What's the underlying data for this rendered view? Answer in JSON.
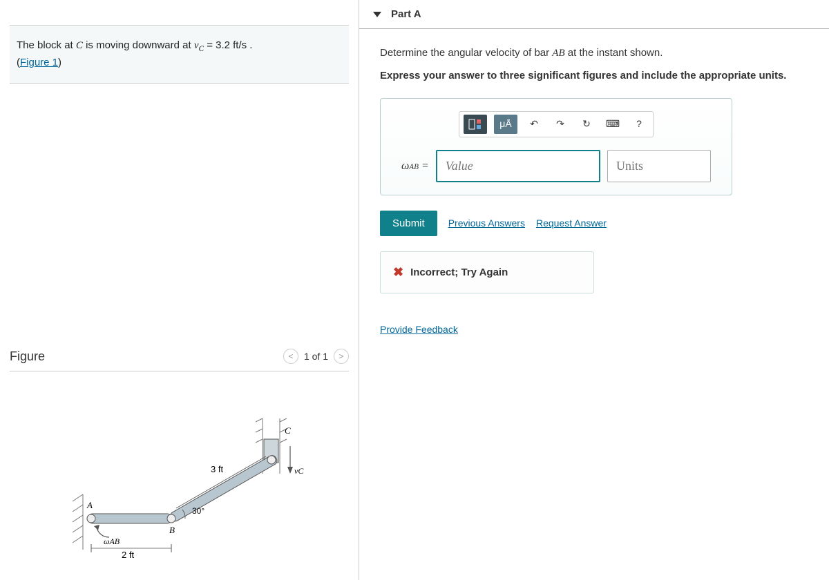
{
  "problem": {
    "text_pre": "The block at ",
    "var1": "C",
    "text_mid1": " is moving downward at ",
    "var2_html": "v",
    "sub2": "C",
    "eq": " = 3.2 ft/s .",
    "figure_link": "Figure 1"
  },
  "figure": {
    "title": "Figure",
    "pager": "1 of 1",
    "labels": {
      "len_bc": "3 ft",
      "len_ab": "2 ft",
      "angle": "30°",
      "A": "A",
      "B": "B",
      "C": "C",
      "wab": "ωAB",
      "vc": "vC"
    }
  },
  "part": {
    "title": "Part A",
    "instruction_pre": "Determine the angular velocity of bar ",
    "bar": "AB",
    "instruction_post": " at the instant shown.",
    "bold": "Express your answer to three significant figures and include the appropriate units."
  },
  "toolbar": {
    "template": "▭",
    "mu": "μÅ",
    "undo": "↶",
    "redo": "↷",
    "reset": "↻",
    "keyboard": "⌨",
    "help": "?"
  },
  "answer": {
    "label": "ωAB = ",
    "value_placeholder": "Value",
    "units_placeholder": "Units"
  },
  "buttons": {
    "submit": "Submit",
    "previous": "Previous Answers",
    "request": "Request Answer"
  },
  "feedback": {
    "text": "Incorrect; Try Again"
  },
  "links": {
    "provide_feedback": "Provide Feedback"
  }
}
